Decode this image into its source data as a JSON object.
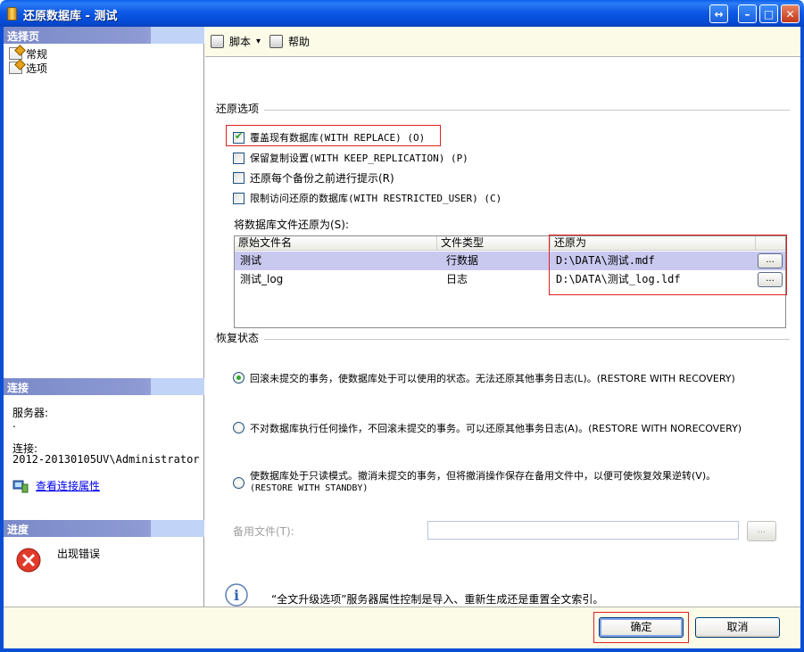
{
  "window": {
    "title": "还原数据库 - 测试"
  },
  "title_buttons": {
    "restore_glyph": "↔",
    "minimize_glyph": "–",
    "maximize_glyph": "□",
    "close_glyph": "✕"
  },
  "left": {
    "select_page_header": "选择页",
    "pages": [
      {
        "label": "常规"
      },
      {
        "label": "选项"
      }
    ],
    "connection_header": "连接",
    "server_label": "服务器:",
    "server_value": ".",
    "connection_label": "连接:",
    "connection_value": "2012-20130105UV\\Administrator",
    "view_properties_link": "查看连接属性",
    "progress_header": "进度",
    "progress_status": "出现错误"
  },
  "toolbar": {
    "script_label": "脚本",
    "script_dropdown_glyph": "▾",
    "help_label": "帮助"
  },
  "restore_options": {
    "group_title": "还原选项",
    "options": [
      {
        "label": "覆盖现有数据库(WITH REPLACE) (O)",
        "checked": true
      },
      {
        "label": "保留复制设置(WITH KEEP_REPLICATION) (P)",
        "checked": false
      },
      {
        "label": "还原每个备份之前进行提示(R)",
        "checked": false
      },
      {
        "label": "限制访问还原的数据库(WITH RESTRICTED_USER) (C)",
        "checked": false
      }
    ]
  },
  "restore_files": {
    "label": "将数据库文件还原为(S):",
    "columns": [
      "原始文件名",
      "文件类型",
      "还原为"
    ],
    "rows": [
      {
        "original": "测试",
        "type": "行数据",
        "restore_as": "D:\\DATA\\测试.mdf",
        "browse": "..."
      },
      {
        "original": "测试_log",
        "type": "日志",
        "restore_as": "D:\\DATA\\测试_log.ldf",
        "browse": "..."
      }
    ]
  },
  "recovery_state": {
    "group_title": "恢复状态",
    "options": [
      {
        "label": "回滚未提交的事务，使数据库处于可以使用的状态。无法还原其他事务日志(L)。(RESTORE WITH RECOVERY)",
        "selected": true
      },
      {
        "label": "不对数据库执行任何操作，不回滚未提交的事务。可以还原其他事务日志(A)。(RESTORE WITH NORECOVERY)",
        "selected": false
      },
      {
        "label": "使数据库处于只读模式。撤消未提交的事务，但将撤消操作保存在备用文件中，以便可使恢复效果逆转(V)。",
        "label_line2": "(RESTORE WITH STANDBY)",
        "selected": false
      }
    ],
    "standby_file_label": "备用文件(T):",
    "standby_file_value": "",
    "standby_browse": "..."
  },
  "info": {
    "glyph": "i",
    "text": "“全文升级选项”服务器属性控制是导入、重新生成还是重置全文索引。"
  },
  "footer": {
    "ok_label": "确定",
    "cancel_label": "取消"
  },
  "colors": {
    "titlebar": "#0a5de8",
    "highlight_box": "#e02020",
    "selected_row": "#c9c9f0",
    "pane_header": "#7b8ac8"
  }
}
